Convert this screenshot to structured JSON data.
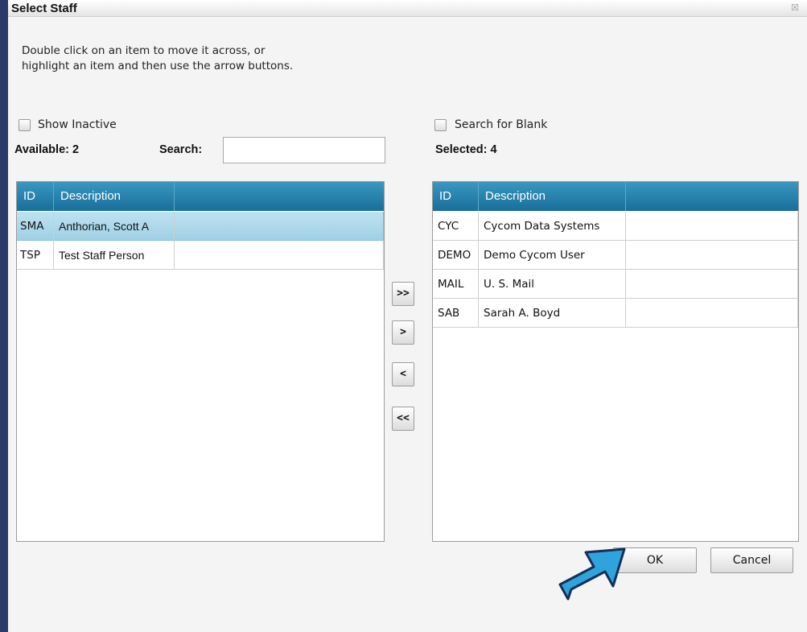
{
  "dialog": {
    "title": "Select Staff",
    "close_glyph": "☒",
    "instructions": [
      "Double click on an item to move it across, or",
      "highlight an item and then use the arrow buttons."
    ]
  },
  "left_panel": {
    "show_inactive_label": "Show Inactive",
    "show_inactive_checked": false,
    "available_label": "Available: 2",
    "search_label": "Search:",
    "search_value": "",
    "columns": [
      "ID",
      "Description"
    ],
    "rows": [
      {
        "id": "SMA",
        "description": "Anthorian, Scott A",
        "selected": true
      },
      {
        "id": "TSP",
        "description": "Test Staff Person",
        "selected": false
      }
    ]
  },
  "right_panel": {
    "search_blank_label": "Search for Blank",
    "search_blank_checked": false,
    "selected_label": "Selected: 4",
    "columns": [
      "ID",
      "Description"
    ],
    "rows": [
      {
        "id": "CYC",
        "description": "Cycom Data Systems"
      },
      {
        "id": "DEMO",
        "description": "Demo Cycom User"
      },
      {
        "id": "MAIL",
        "description": "U. S. Mail"
      },
      {
        "id": "SAB",
        "description": "Sarah A. Boyd"
      }
    ]
  },
  "transfer_buttons": {
    "move_all_right": ">>",
    "move_right": ">",
    "move_left": "<",
    "move_all_left": "<<"
  },
  "footer": {
    "ok_label": "OK",
    "cancel_label": "Cancel"
  },
  "colors": {
    "header_blue": "#1e7aa6",
    "selected_row": "#a9d6ea",
    "pointer_arrow": "#2fa3dc",
    "backdrop": "#2b3a68"
  },
  "icons": {
    "pointer": "arrow-pointer-icon",
    "close": "close-icon"
  }
}
